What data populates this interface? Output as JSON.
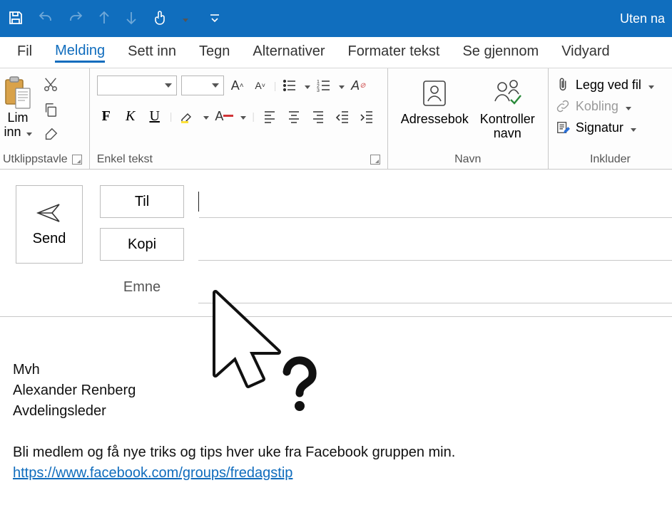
{
  "window": {
    "title": "Uten na"
  },
  "tabs": {
    "fil": "Fil",
    "melding": "Melding",
    "sett_inn": "Sett inn",
    "tegn": "Tegn",
    "alternativer": "Alternativer",
    "formater_tekst": "Formater tekst",
    "se_gjennom": "Se gjennom",
    "vidyard": "Vidyard"
  },
  "ribbon": {
    "clipboard": {
      "paste_label": "Lim\ninn",
      "group_label": "Utklippstavle"
    },
    "font": {
      "group_label": "Enkel tekst"
    },
    "names": {
      "addressbook": "Adressebok",
      "check_names": "Kontroller\nnavn",
      "group_label": "Navn"
    },
    "include": {
      "attach": "Legg ved fil",
      "link": "Kobling",
      "signature": "Signatur",
      "group_label": "Inkluder"
    }
  },
  "compose": {
    "send": "Send",
    "to": "Til",
    "cc": "Kopi",
    "subject_label": "Emne",
    "to_value": "",
    "cc_value": "",
    "subject_value": ""
  },
  "body": {
    "l1": "Mvh",
    "l2": "Alexander Renberg",
    "l3": "Avdelingsleder",
    "l4": "Bli medlem og få nye triks og tips hver uke fra Facebook gruppen min.",
    "link_text": "https://www.facebook.com/groups/fredagstip",
    "link_href": "https://www.facebook.com/groups/fredagstip"
  }
}
